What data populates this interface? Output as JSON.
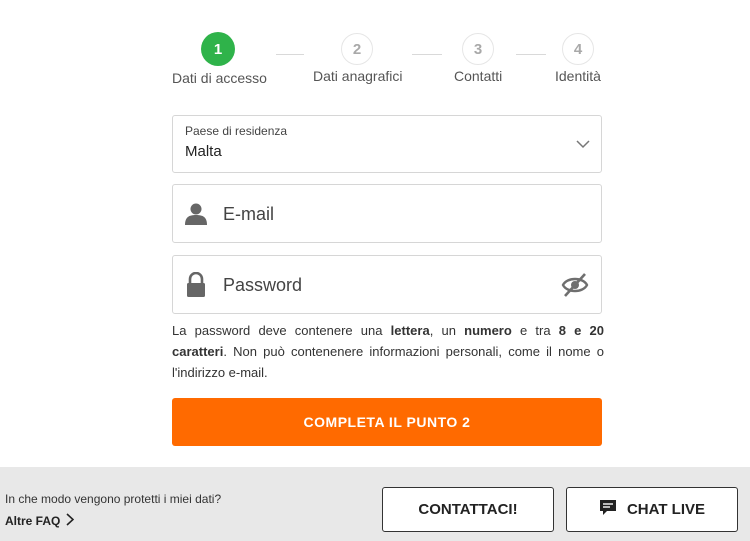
{
  "stepper": {
    "steps": [
      {
        "number": "1",
        "label": "Dati di accesso",
        "state": "active"
      },
      {
        "number": "2",
        "label": "Dati anagrafici",
        "state": "inactive"
      },
      {
        "number": "3",
        "label": "Contatti",
        "state": "inactive"
      },
      {
        "number": "4",
        "label": "Identità",
        "state": "inactive"
      }
    ],
    "active_color": "#2fb34a"
  },
  "form": {
    "country": {
      "caption": "Paese di residenza",
      "value": "Malta",
      "icon": "chevron-down-icon"
    },
    "email": {
      "placeholder": "E-mail",
      "icon": "user-icon"
    },
    "password": {
      "placeholder": "Password",
      "icon": "lock-icon",
      "toggle_icon": "eye-off-icon"
    },
    "help": {
      "t1": "La password deve contenere una ",
      "b1": "lettera",
      "t2": ", un ",
      "b2": "numero",
      "t3": " e tra ",
      "b3": "8 e 20 caratteri",
      "t4": ". Non può contenenere informazioni personali, come il nome o l'indirizzo e-mail."
    },
    "submit_label": "COMPLETA IL PUNTO 2",
    "submit_color": "#ff6a00"
  },
  "footer": {
    "question": "In che modo vengono protetti i miei dati?",
    "faq_link": "Altre FAQ",
    "contact_label": "CONTATTACI!",
    "chat_label": "CHAT LIVE",
    "chat_icon": "chat-icon"
  }
}
